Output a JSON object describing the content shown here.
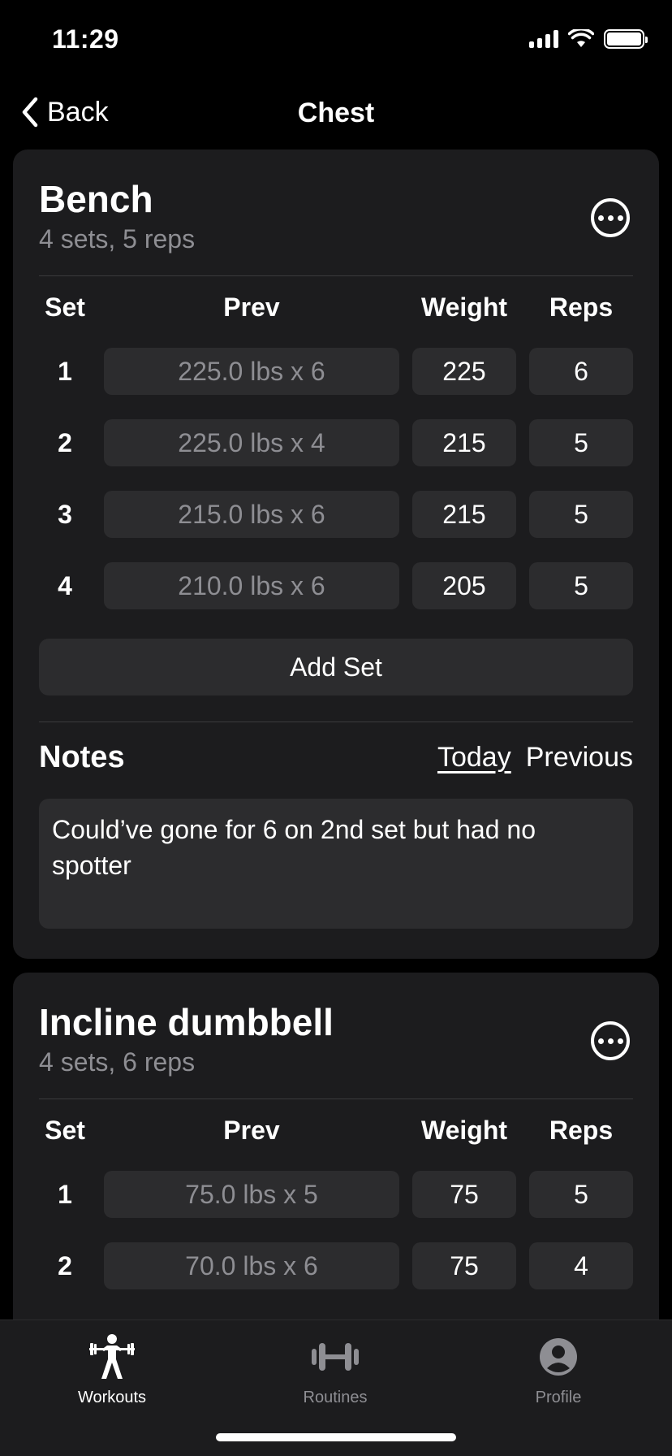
{
  "status": {
    "time": "11:29"
  },
  "nav": {
    "back_label": "Back",
    "title": "Chest"
  },
  "columns": {
    "set": "Set",
    "prev": "Prev",
    "weight": "Weight",
    "reps": "Reps"
  },
  "exercises": [
    {
      "name": "Bench",
      "summary": "4 sets, 5 reps",
      "sets": [
        {
          "num": "1",
          "prev": "225.0 lbs x 6",
          "weight": "225",
          "reps": "6"
        },
        {
          "num": "2",
          "prev": "225.0 lbs x 4",
          "weight": "215",
          "reps": "5"
        },
        {
          "num": "3",
          "prev": "215.0 lbs x 6",
          "weight": "215",
          "reps": "5"
        },
        {
          "num": "4",
          "prev": "210.0 lbs x 6",
          "weight": "205",
          "reps": "5"
        }
      ],
      "add_set_label": "Add Set",
      "notes": {
        "title": "Notes",
        "tab_today": "Today",
        "tab_previous": "Previous",
        "text": "Could’ve gone for 6 on 2nd set but had no spotter"
      }
    },
    {
      "name": "Incline dumbbell",
      "summary": "4 sets, 6 reps",
      "sets": [
        {
          "num": "1",
          "prev": "75.0 lbs x 5",
          "weight": "75",
          "reps": "5"
        },
        {
          "num": "2",
          "prev": "70.0 lbs x 6",
          "weight": "75",
          "reps": "4"
        }
      ]
    }
  ],
  "tabbar": {
    "items": [
      {
        "label": "Workouts",
        "icon": "weightlifter-icon",
        "active": true
      },
      {
        "label": "Routines",
        "icon": "dumbbell-icon",
        "active": false
      },
      {
        "label": "Profile",
        "icon": "person-circle-icon",
        "active": false
      }
    ]
  },
  "colors": {
    "background": "#000000",
    "card": "#1c1c1e",
    "field": "#2c2c2e",
    "secondary_text": "#8e8e93"
  }
}
